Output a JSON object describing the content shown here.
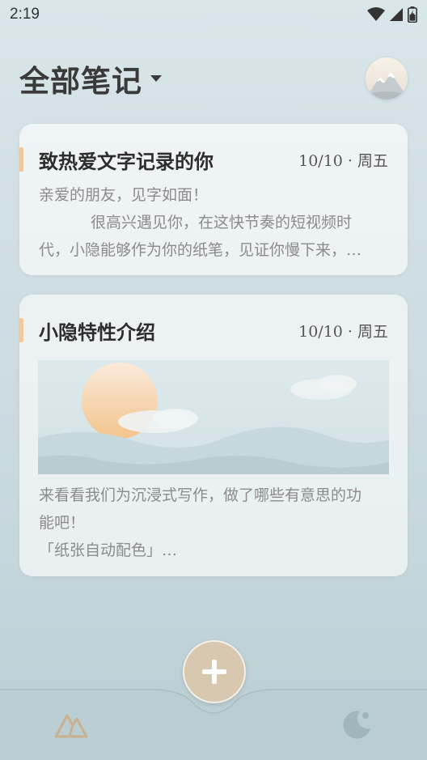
{
  "status_bar": {
    "time": "2:19",
    "icons": [
      "wifi-icon",
      "signal-icon",
      "battery-icon"
    ]
  },
  "header": {
    "title": "全部笔记",
    "dropdown_icon": "caret-down-icon",
    "avatar": "mountain-avatar"
  },
  "notes": [
    {
      "title": "致热爱文字记录的你",
      "date": "10/10 · 周五",
      "lines": [
        "亲爱的朋友，见字如面！",
        "很高兴遇见你，在这快节奏的短视频时",
        "代，小隐能够作为你的纸笔，见证你慢下来，…"
      ]
    },
    {
      "title": "小隐特性介绍",
      "date": "10/10 · 周五",
      "lines": [
        "来看看我们为沉浸式写作，做了哪些有意思的功",
        "能吧！",
        "「纸张自动配色」…"
      ],
      "image": "sun-clouds-landscape"
    }
  ],
  "bottom_nav": {
    "left_icon": "mountain-icon",
    "fab_icon": "plus-icon",
    "right_icon": "moon-icon"
  },
  "colors": {
    "accent": "#f0c99a",
    "fab": "#d9c8b0",
    "background": "#cfdee3"
  }
}
